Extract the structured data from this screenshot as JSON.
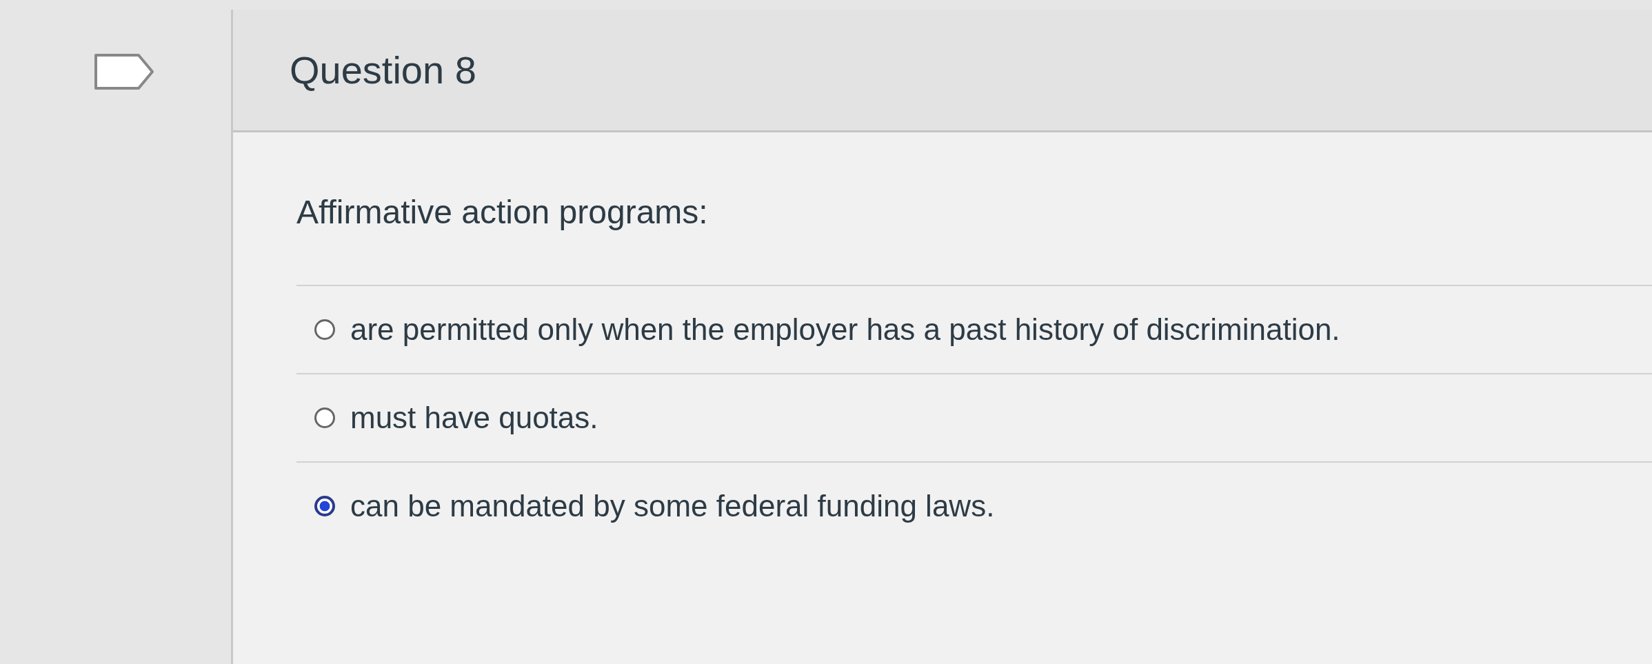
{
  "question": {
    "title": "Question 8",
    "prompt": "Affirmative action programs:",
    "options": [
      {
        "label": "are permitted only when the employer has a past history of discrimination.",
        "selected": false
      },
      {
        "label": "must have quotas.",
        "selected": false
      },
      {
        "label": "can be mandated by some federal funding laws.",
        "selected": true
      }
    ]
  }
}
